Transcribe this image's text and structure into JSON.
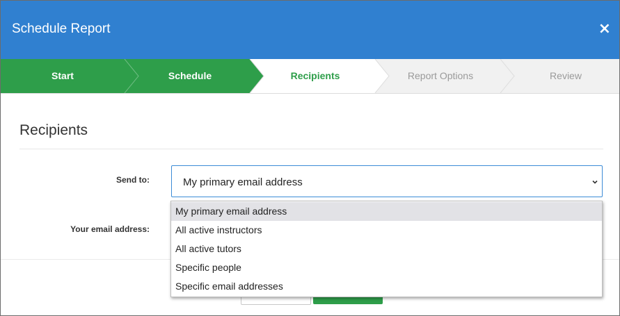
{
  "modal": {
    "title": "Schedule Report",
    "close_symbol": "×"
  },
  "wizard": {
    "steps": [
      {
        "label": "Start",
        "state": "completed"
      },
      {
        "label": "Schedule",
        "state": "completed"
      },
      {
        "label": "Recipients",
        "state": "active"
      },
      {
        "label": "Report Options",
        "state": "upcoming"
      },
      {
        "label": "Review",
        "state": "upcoming"
      }
    ]
  },
  "section": {
    "title": "Recipients"
  },
  "form": {
    "send_to_label": "Send to:",
    "send_to_value": "My primary email address",
    "email_label": "Your email address:"
  },
  "dropdown": {
    "options": [
      "My primary email address",
      "All active instructors",
      "All active tutors",
      "Specific people",
      "Specific email addresses"
    ],
    "selected_index": 0
  },
  "icons": {
    "close": "close-icon",
    "select_arrow": "chevron-down-icon"
  },
  "colors": {
    "header": "#3080d0",
    "step_completed": "#2e9e4a",
    "step_active_text": "#2e9e4a",
    "step_upcoming_text": "#9a9a9a",
    "upcoming_step_bg": "#f1f1f1",
    "select_border": "#3b8bd6"
  }
}
